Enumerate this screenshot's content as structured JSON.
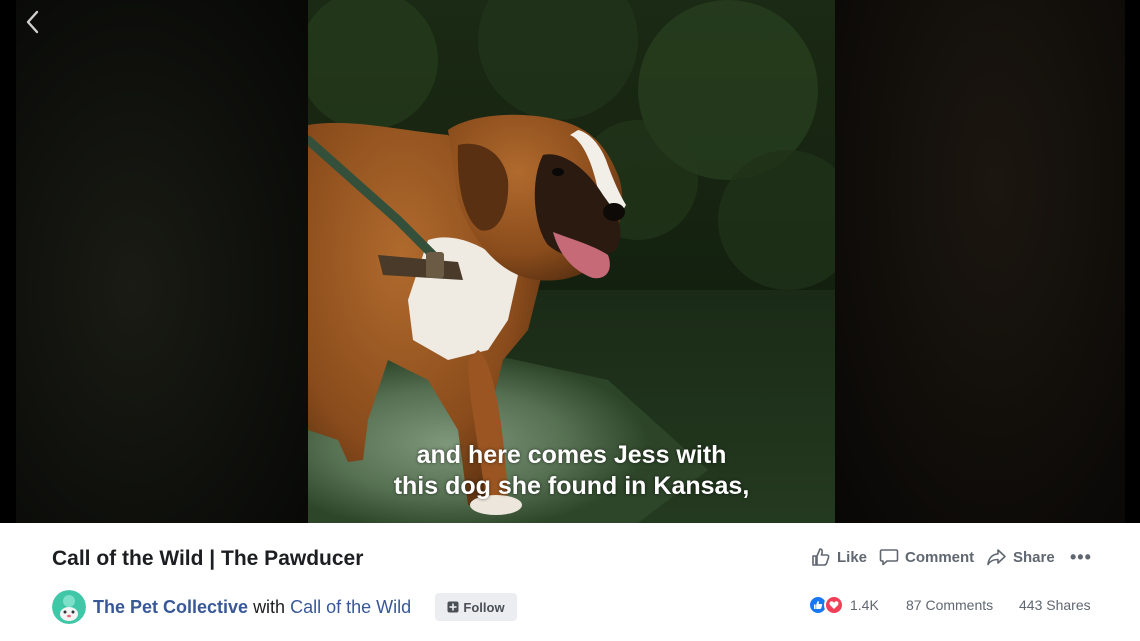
{
  "video": {
    "caption_line1": "and here comes Jess with",
    "caption_line2": "this dog she found in Kansas,"
  },
  "post": {
    "title": "Call of the Wild | The Pawducer",
    "page_name": "The Pet Collective",
    "with_word": "with",
    "tagged_name": "Call of the Wild",
    "follow_label": "Follow"
  },
  "actions": {
    "like_label": "Like",
    "comment_label": "Comment",
    "share_label": "Share",
    "more_label": "•••"
  },
  "stats": {
    "reactions_count": "1.4K",
    "comments_text": "87 Comments",
    "shares_text": "443 Shares"
  },
  "colors": {
    "link_blue": "#385898",
    "like_blue": "#1877f2",
    "love_red": "#f33e58",
    "text_dark": "#1c1e21",
    "text_gray": "#606770"
  },
  "icons": [
    "back-arrow-icon",
    "like-thumb-icon",
    "comment-bubble-icon",
    "share-arrow-icon",
    "more-dots-icon",
    "follow-plus-icon",
    "like-reaction-icon",
    "love-reaction-icon"
  ]
}
